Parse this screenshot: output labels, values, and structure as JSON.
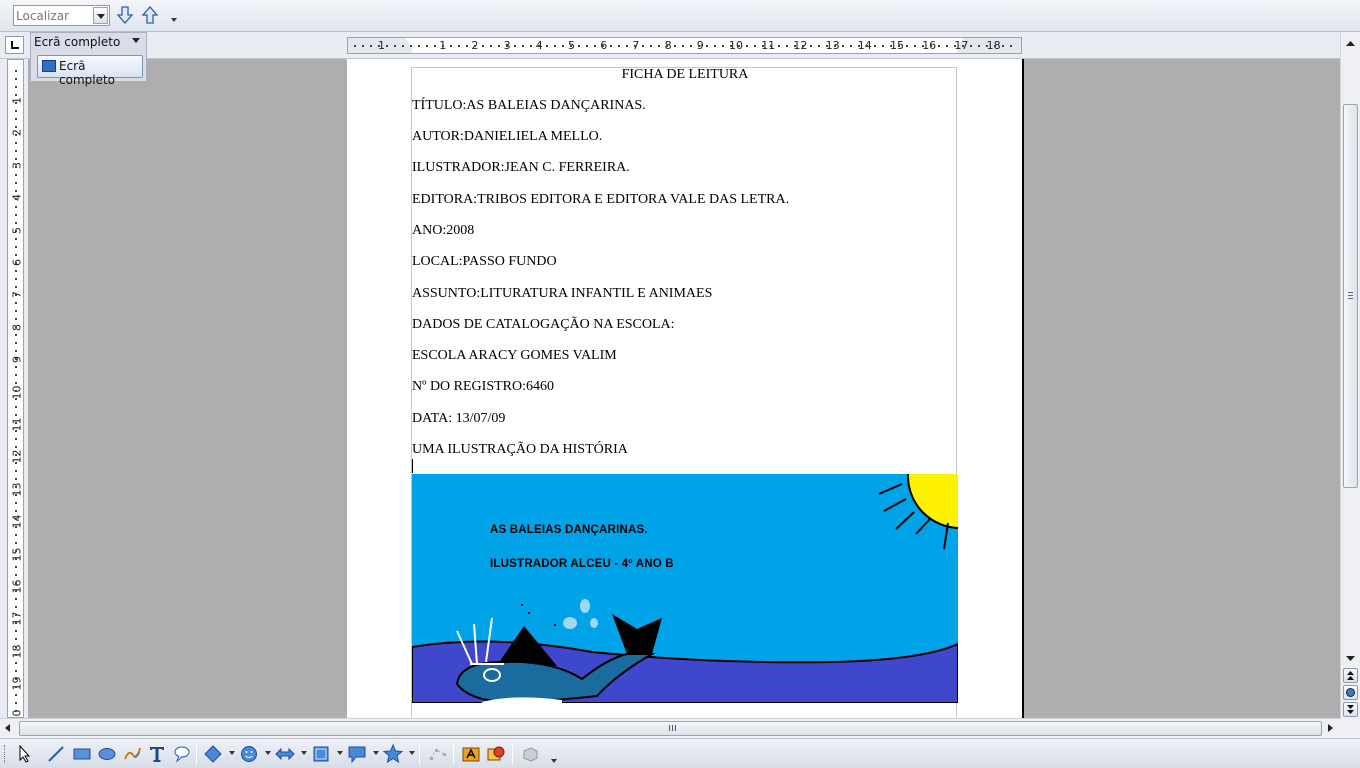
{
  "find_toolbar": {
    "search_placeholder": "Localizar",
    "find_next_icon": "arrow-down-icon",
    "find_prev_icon": "arrow-up-icon"
  },
  "fullscreen_toolbar": {
    "title": "Ecrã completo",
    "button_label": "Ecrã completo"
  },
  "horizontal_ruler": {
    "labels": [
      "1",
      "1",
      "2",
      "3",
      "4",
      "5",
      "6",
      "7",
      "8",
      "9",
      "10",
      "11",
      "12",
      "13",
      "14",
      "15",
      "16",
      "17",
      "18"
    ]
  },
  "vertical_ruler": {
    "labels": [
      "1",
      "2",
      "3",
      "4",
      "5",
      "6",
      "7",
      "8",
      "9",
      "10",
      "11",
      "12",
      "13",
      "14",
      "15",
      "16",
      "17",
      "18",
      "19",
      "20"
    ]
  },
  "document": {
    "heading": "FICHA DE LEITURA",
    "lines": [
      "TÍTULO:AS BALEIAS DANÇARINAS.",
      "AUTOR:DANIELIELA MELLO.",
      "ILUSTRADOR:JEAN  C. FERREIRA.",
      "EDITORA:TRIBOS EDITORA E EDITORA  VALE DAS LETRA.",
      "ANO:2008",
      "LOCAL:PASSO FUNDO",
      "ASSUNTO:LITURATURA INFANTIL E ANIMAES",
      "DADOS DE CATALOGAÇÃO NA ESCOLA:",
      "ESCOLA ARACY GOMES VALIM",
      "Nº DO REGISTRO:6460",
      "DATA: 13/07/09",
      "UMA ILUSTRAÇÃO DA HISTÓRIA"
    ],
    "illustration": {
      "title": "AS BALEIAS DANÇARINAS.",
      "credit": "ILUSTRADOR ALCEU - 4º ANO B",
      "colors": {
        "sky": "#00a2e8",
        "sea": "#3f48cc",
        "sun": "#fff200",
        "whale": "#1a5f8a"
      }
    }
  },
  "drawing_toolbar": {
    "tools": [
      "select-icon",
      "line-icon",
      "rectangle-icon",
      "ellipse-icon",
      "freeform-icon",
      "text-icon",
      "callout-icon",
      "basic-shapes-icon",
      "symbol-shapes-icon",
      "block-arrows-icon",
      "flowchart-icon",
      "callouts-icon",
      "stars-icon",
      "points-icon",
      "fontwork-icon",
      "from-file-icon",
      "extrusion-icon"
    ]
  }
}
